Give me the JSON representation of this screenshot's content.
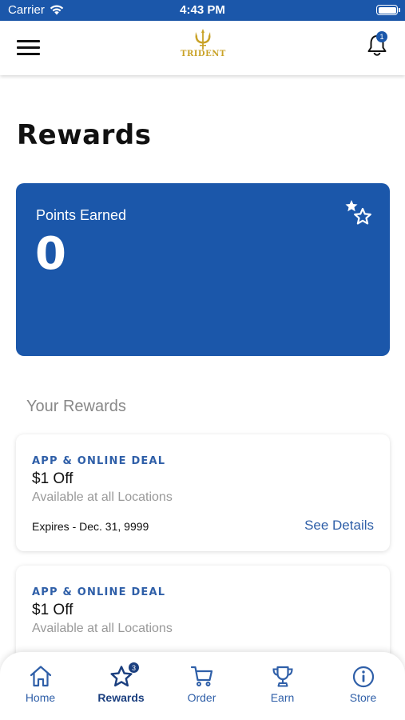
{
  "status_bar": {
    "carrier": "Carrier",
    "time": "4:43 PM"
  },
  "header": {
    "logo_text": "TRIDENT",
    "notification_count": "1"
  },
  "page": {
    "title": "Rewards"
  },
  "points_card": {
    "label": "Points Earned",
    "value": "0",
    "icon": "stars-icon"
  },
  "rewards_section": {
    "heading": "Your Rewards"
  },
  "rewards": [
    {
      "tag": "APP & ONLINE DEAL",
      "title": "$1 Off",
      "subtitle": "Available at all Locations",
      "expires": "Expires - Dec. 31, 9999",
      "details_label": "See Details"
    },
    {
      "tag": "APP & ONLINE DEAL",
      "title": "$1 Off",
      "subtitle": "Available at all Locations"
    }
  ],
  "tab_bar": {
    "tabs": [
      {
        "label": "Home",
        "icon": "home-icon"
      },
      {
        "label": "Rewards",
        "icon": "star-icon",
        "badge": "3",
        "active": true
      },
      {
        "label": "Order",
        "icon": "cart-icon"
      },
      {
        "label": "Earn",
        "icon": "trophy-icon"
      },
      {
        "label": "Store",
        "icon": "info-icon"
      }
    ]
  },
  "colors": {
    "brand_blue": "#1b57aa",
    "tab_blue": "#2f5fa8",
    "logo_gold": "#c9a227"
  }
}
